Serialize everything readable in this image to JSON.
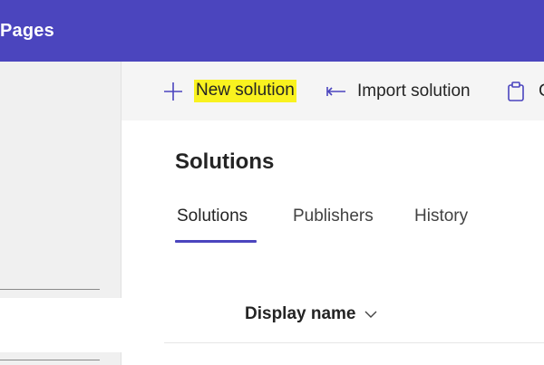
{
  "app": {
    "title": "Pages"
  },
  "command_bar": {
    "new_solution_label": "New solution",
    "import_solution_label": "Import solution",
    "clipboard_label": "C"
  },
  "page": {
    "title": "Solutions"
  },
  "tabs": [
    {
      "label": "Solutions",
      "selected": true
    },
    {
      "label": "Publishers",
      "selected": false
    },
    {
      "label": "History",
      "selected": false
    }
  ],
  "grid": {
    "columns": [
      {
        "label": "Display name",
        "sortable": true
      }
    ]
  },
  "icons": {
    "new": "plus-icon",
    "import": "import-arrow-icon",
    "clipboard": "clipboard-icon",
    "sort": "chevron-down-icon"
  },
  "colors": {
    "brand": "#4b45be",
    "highlight": "#f9f21f"
  }
}
